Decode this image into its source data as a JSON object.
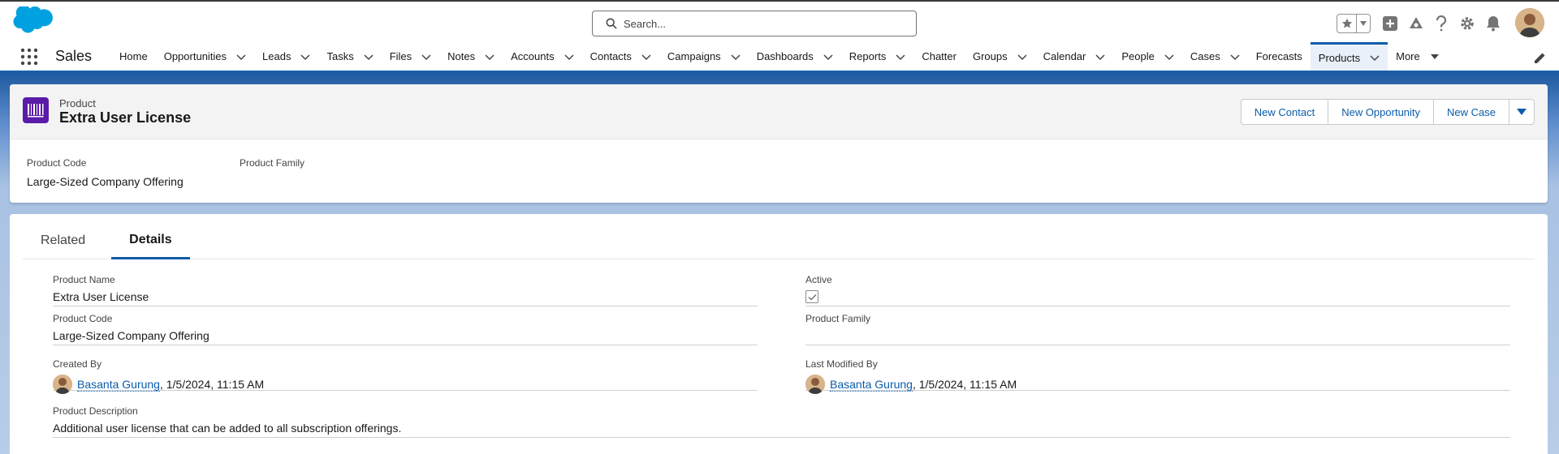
{
  "header": {
    "search_placeholder": "Search..."
  },
  "nav": {
    "app_name": "Sales",
    "items": [
      {
        "label": "Home",
        "chevron": false
      },
      {
        "label": "Opportunities",
        "chevron": true
      },
      {
        "label": "Leads",
        "chevron": true
      },
      {
        "label": "Tasks",
        "chevron": true
      },
      {
        "label": "Files",
        "chevron": true
      },
      {
        "label": "Notes",
        "chevron": true
      },
      {
        "label": "Accounts",
        "chevron": true
      },
      {
        "label": "Contacts",
        "chevron": true
      },
      {
        "label": "Campaigns",
        "chevron": true
      },
      {
        "label": "Dashboards",
        "chevron": true
      },
      {
        "label": "Reports",
        "chevron": true
      },
      {
        "label": "Chatter",
        "chevron": false
      },
      {
        "label": "Groups",
        "chevron": true
      },
      {
        "label": "Calendar",
        "chevron": true
      },
      {
        "label": "People",
        "chevron": true
      },
      {
        "label": "Cases",
        "chevron": true
      },
      {
        "label": "Forecasts",
        "chevron": false
      },
      {
        "label": "Products",
        "chevron": true,
        "active": true
      },
      {
        "label": "More",
        "chevron": false,
        "caret": true
      }
    ]
  },
  "record": {
    "object_type": "Product",
    "name": "Extra User License",
    "actions": [
      "New Contact",
      "New Opportunity",
      "New Case"
    ],
    "highlights": [
      {
        "label": "Product Code",
        "value": "Large-Sized Company Offering"
      },
      {
        "label": "Product Family",
        "value": ""
      }
    ]
  },
  "tabs": [
    "Related",
    "Details"
  ],
  "active_tab": "Details",
  "details": {
    "product_name_label": "Product Name",
    "product_name": "Extra User License",
    "active_label": "Active",
    "active": true,
    "product_code_label": "Product Code",
    "product_code": "Large-Sized Company Offering",
    "product_family_label": "Product Family",
    "product_family": "",
    "created_by_label": "Created By",
    "created_by_user": "Basanta Gurung",
    "created_by_date": ", 1/5/2024, 11:15 AM",
    "modified_by_label": "Last Modified By",
    "modified_by_user": "Basanta Gurung",
    "modified_by_date": ", 1/5/2024, 11:15 AM",
    "description_label": "Product Description",
    "description": "Additional user license that can be added to all subscription offerings."
  },
  "colors": {
    "brand": "#0b5cab",
    "product_icon": "#5a1ba9",
    "cloud": "#00a1e0"
  }
}
